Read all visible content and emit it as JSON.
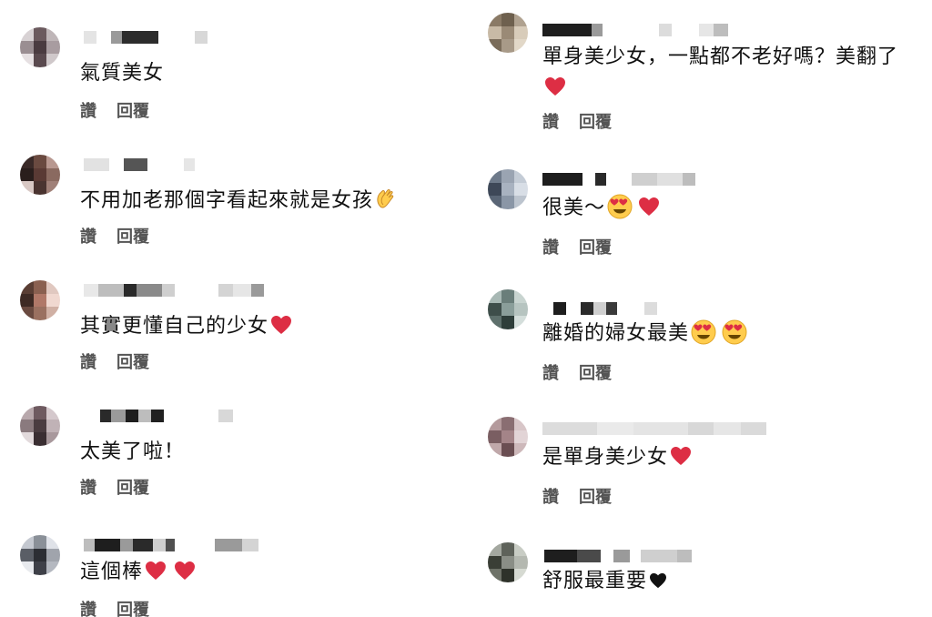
{
  "actions": {
    "like_label": "讚",
    "reply_label": "回覆"
  },
  "colors": {
    "heart": "#dd2e44",
    "face": "#ffcc4d",
    "black_heart": "#111111",
    "action_text": "#555555"
  },
  "left_comments": [
    {
      "text": "氣質美女",
      "emoji": []
    },
    {
      "text": "不用加老那個字看起來就是女孩",
      "emoji": [
        "clapping-hands-icon"
      ]
    },
    {
      "text": "其實更懂自己的少女",
      "emoji": [
        "red-heart-icon"
      ]
    },
    {
      "text": "太美了啦！",
      "emoji": []
    },
    {
      "text": "這個棒",
      "emoji": [
        "red-heart-icon",
        "red-heart-icon"
      ]
    }
  ],
  "right_comments": [
    {
      "text": "單身美少女，一點都不老好嗎？美翻了",
      "emoji": [
        "red-heart-icon"
      ]
    },
    {
      "text": "很美～",
      "emoji": [
        "heart-eyes-face-icon",
        "red-heart-icon"
      ]
    },
    {
      "text": "離婚的婦女最美",
      "emoji": [
        "heart-eyes-face-icon",
        "heart-eyes-face-icon"
      ]
    },
    {
      "text": "是單身美少女",
      "emoji": [
        "red-heart-icon"
      ]
    },
    {
      "text": "舒服最重要",
      "emoji": [
        "black-heart-icon"
      ]
    }
  ]
}
